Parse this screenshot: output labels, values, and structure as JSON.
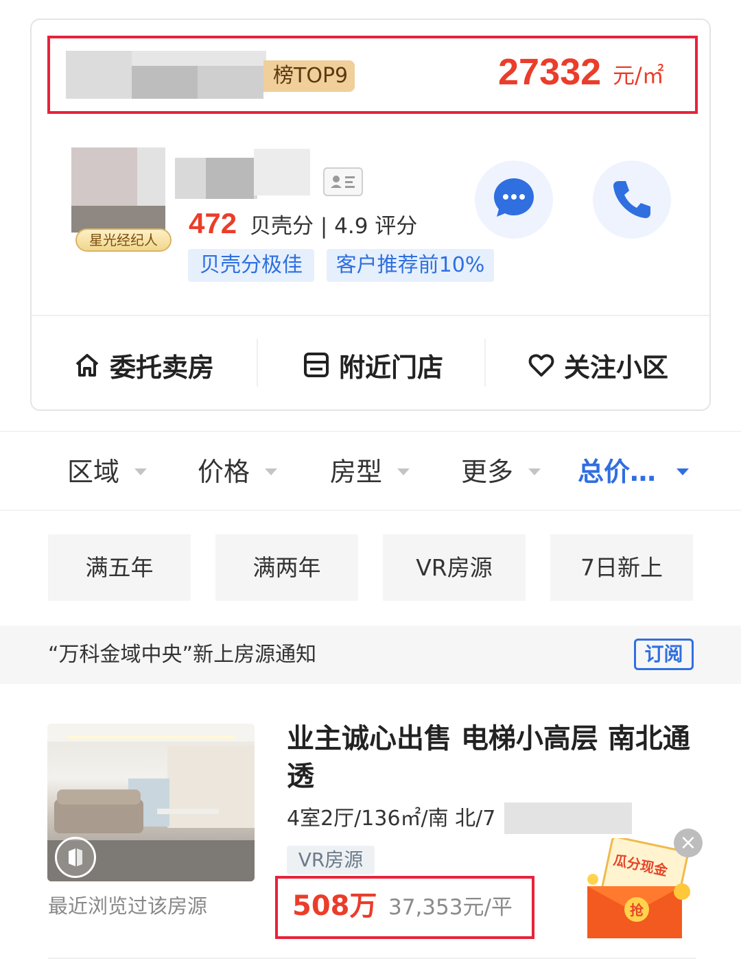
{
  "top_card": {
    "rank_tag": "榜TOP9",
    "avg_price_value": "27332",
    "avg_price_unit": "元/㎡",
    "agent": {
      "badge": "星光经纪人",
      "score": "472",
      "score_text": "贝壳分 | 4.9 评分",
      "tags": [
        "贝壳分极佳",
        "客户推荐前10%"
      ]
    },
    "actions": [
      {
        "label": "委托卖房",
        "icon": "home-icon"
      },
      {
        "label": "附近门店",
        "icon": "store-icon"
      },
      {
        "label": "关注小区",
        "icon": "heart-icon"
      }
    ]
  },
  "filters": {
    "items": [
      "区域",
      "价格",
      "房型",
      "更多",
      "总价…"
    ]
  },
  "chips": [
    "满五年",
    "满两年",
    "VR房源",
    "7日新上"
  ],
  "subscribe": {
    "text": "“万科金域中央”新上房源通知",
    "button": "订阅"
  },
  "listing": {
    "title": "业主诚心出售 电梯小高层 南北通透",
    "info": "4室2厅/136㎡/南 北/7",
    "vr_tag": "VR房源",
    "price": "508万",
    "unit_price": "37,353元/平",
    "recent_note": "最近浏览过该房源"
  },
  "promo": {
    "text": "瓜分现金",
    "grab": "抢"
  },
  "colors": {
    "accent_red": "#ea3d2a",
    "accent_blue": "#2f6fe0",
    "highlight_border": "#e8223a"
  }
}
